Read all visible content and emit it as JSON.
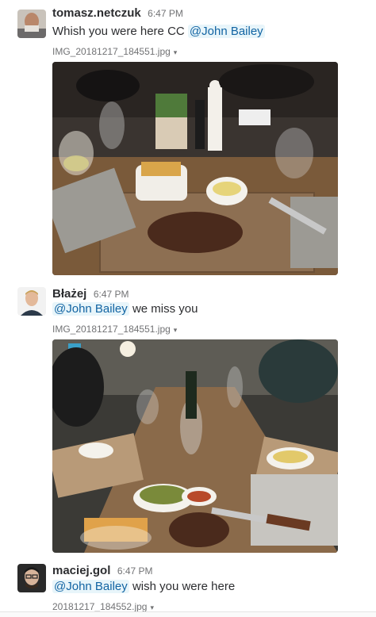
{
  "messages": [
    {
      "user": "tomasz.netczuk",
      "time": "6:47 PM",
      "text_before": "Whish you were here CC ",
      "mention": "@John Bailey",
      "text_after": "",
      "file": "IMG_20181217_184551.jpg",
      "avatar_icon": "user-photo-icon"
    },
    {
      "user": "Błażej",
      "time": "6:47 PM",
      "text_before": "",
      "mention": "@John Bailey",
      "text_after": " we miss you",
      "file": "IMG_20181217_184551.jpg",
      "avatar_icon": "user-photo-icon"
    },
    {
      "user": "maciej.gol",
      "time": "6:47 PM",
      "text_before": "",
      "mention": "@John Bailey",
      "text_after": " wish you were here",
      "file": "20181217_184552.jpg",
      "avatar_icon": "user-photo-icon"
    }
  ],
  "caret_icon": "▾",
  "colors": {
    "mention_bg": "#e8f5fa",
    "mention_fg": "#1264a3",
    "text": "#2c2d30",
    "meta": "#717274"
  }
}
